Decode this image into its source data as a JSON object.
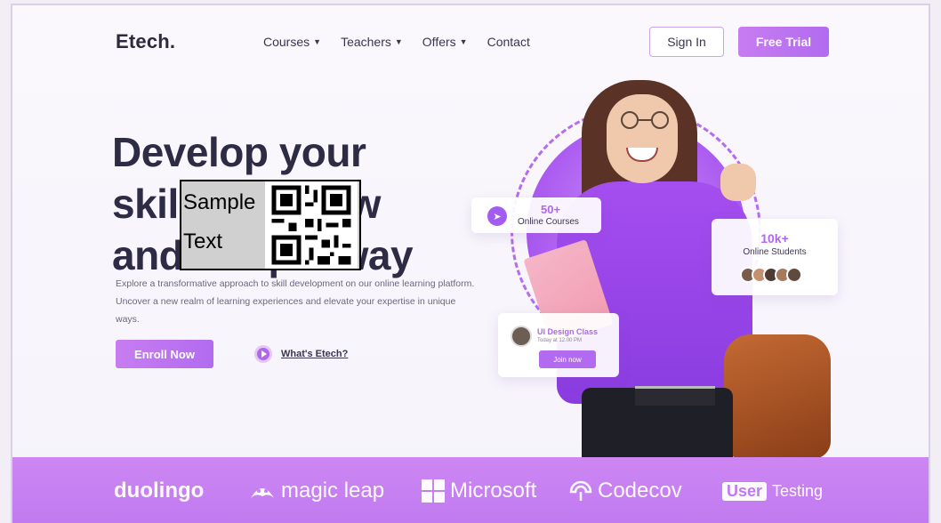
{
  "nav": {
    "logo": "Etech.",
    "items": [
      {
        "label": "Courses",
        "has_dropdown": true
      },
      {
        "label": "Teachers",
        "has_dropdown": true
      },
      {
        "label": "Offers",
        "has_dropdown": true
      },
      {
        "label": "Contact",
        "has_dropdown": false
      }
    ],
    "sign_in": "Sign In",
    "free_trial": "Free Trial"
  },
  "hero": {
    "title_line1": "Develop your",
    "title_line2": "skills in a new",
    "title_line3": "and unique way",
    "description": "Explore a transformative approach to skill development on our online learning platform. Uncover a new realm of learning experiences and elevate your expertise in unique ways.",
    "enroll_button": "Enroll Now",
    "whats_link": "What's Etech?"
  },
  "overlay": {
    "qr_text_line1": "Sample",
    "qr_text_line2": "Text"
  },
  "cards": {
    "courses": {
      "number": "50+",
      "label": "Online Courses"
    },
    "students": {
      "number": "10k+",
      "label": "Online Students"
    },
    "class": {
      "title": "UI Design Class",
      "subtitle": "Today at 12:00 PM",
      "join": "Join now"
    }
  },
  "partners": {
    "duolingo": "duolingo",
    "magic_leap": "magic leap",
    "microsoft": "Microsoft",
    "codecov": "Codecov",
    "user_box": "User",
    "testing": "Testing"
  },
  "colors": {
    "accent": "#b26bf0",
    "band": "#c97ff1",
    "title": "#2e2b45"
  }
}
